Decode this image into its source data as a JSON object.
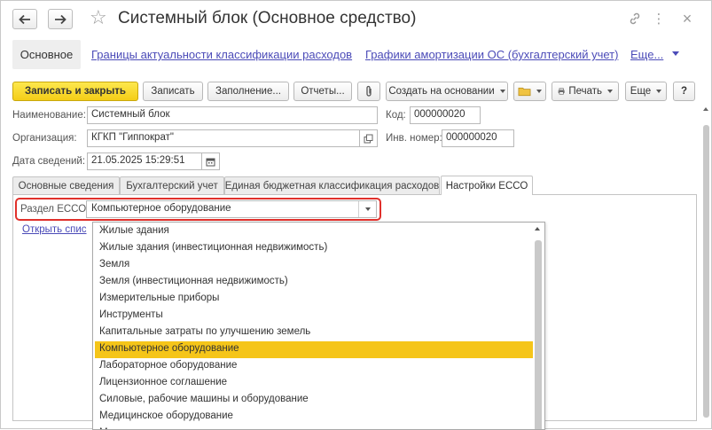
{
  "window": {
    "title": "Системный блок (Основное средство)",
    "icons": [
      "link-icon",
      "more-vertical-icon",
      "close-icon"
    ],
    "close_glyph": "×",
    "more_glyph": "⋮"
  },
  "sections": {
    "active": "Основное",
    "links": [
      "Границы актуальности классификации расходов",
      "Графики амортизации ОС (бухгалтерский учет)",
      "Еще..."
    ]
  },
  "toolbar": {
    "save_close": "Записать и закрыть",
    "save": "Записать",
    "fill": "Заполнение...",
    "reports": "Отчеты...",
    "create_based": "Создать на основании",
    "print": "Печать",
    "more": "Еще",
    "help": "?"
  },
  "form": {
    "name_label": "Наименование:",
    "name_value": "Системный блок",
    "code_label": "Код:",
    "code_value": "000000020",
    "org_label": "Организация:",
    "org_value": "КГКП \"Гиппократ\"",
    "inv_label": "Инв. номер:",
    "inv_value": "000000020",
    "date_label": "Дата сведений:",
    "date_value": "21.05.2025 15:29:51"
  },
  "tabs": [
    {
      "label": "Основные сведения"
    },
    {
      "label": "Бухгалтерский учет"
    },
    {
      "label": "Единая бюджетная классификация расходов"
    },
    {
      "label": "Настройки ЕССО"
    }
  ],
  "esso": {
    "label": "Раздел ЕССО:",
    "value": "Компьютерное оборудование",
    "open_link": "Открыть спис"
  },
  "dropdown": {
    "items": [
      "Жилые здания",
      "Жилые здания (инвестиционная недвижимость)",
      "Земля",
      "Земля (инвестиционная недвижимость)",
      "Измерительные приборы",
      "Инструменты",
      "Капитальные затраты по улучшению земель",
      "Компьютерное оборудование",
      "Лабораторное оборудование",
      "Лицензионное соглашение",
      "Силовые, рабочие машины и оборудование",
      "Медицинское оборудование",
      "М"
    ],
    "selected": "Компьютерное оборудование",
    "selected_color": "#f5c519"
  },
  "colors": {
    "primary_button": "#f4cd17",
    "link": "#4b4bb8",
    "highlight_outline": "#e0302b"
  }
}
